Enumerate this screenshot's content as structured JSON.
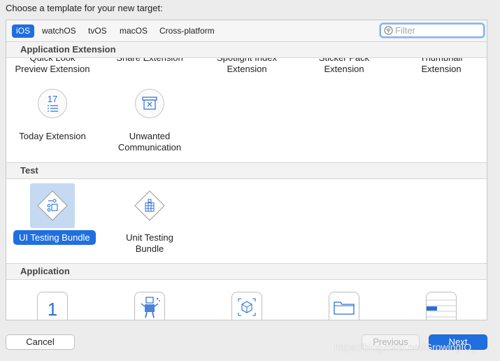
{
  "dialog": {
    "heading": "Choose a template for your new target:"
  },
  "platform_tabs": [
    {
      "label": "iOS",
      "selected": true
    },
    {
      "label": "watchOS",
      "selected": false
    },
    {
      "label": "tvOS",
      "selected": false
    },
    {
      "label": "macOS",
      "selected": false
    },
    {
      "label": "Cross-platform",
      "selected": false
    }
  ],
  "filter": {
    "placeholder": "Filter",
    "value": ""
  },
  "sections": {
    "app_extension": {
      "title": "Application Extension",
      "partial_items": [
        {
          "line1": "Quick Look",
          "line2": "Preview Extension"
        },
        {
          "line1": "Share Extension",
          "line2": ""
        },
        {
          "line1": "Spotlight Index",
          "line2": "Extension"
        },
        {
          "line1": "Sticker Pack",
          "line2": "Extension"
        },
        {
          "line1": "Thumbnail",
          "line2": "Extension"
        }
      ],
      "items": [
        {
          "line1": "Today Extension",
          "line2": "",
          "icon": "calendar-list-icon",
          "icon_text": "17"
        },
        {
          "line1": "Unwanted",
          "line2": "Communication",
          "icon": "envelope-x-icon"
        }
      ]
    },
    "test": {
      "title": "Test",
      "items": [
        {
          "line1": "UI Testing Bundle",
          "icon": "ui-test-icon",
          "selected": true
        },
        {
          "line1": "Unit Testing",
          "line2": "Bundle",
          "icon": "unit-test-icon",
          "selected": false
        }
      ]
    },
    "application": {
      "title": "Application",
      "items": [
        {
          "icon": "single-view-app-icon",
          "icon_text": "1"
        },
        {
          "icon": "game-app-icon"
        },
        {
          "icon": "augmented-reality-app-icon"
        },
        {
          "icon": "document-app-icon"
        },
        {
          "icon": "tabbed-app-icon"
        }
      ]
    }
  },
  "buttons": {
    "cancel": "Cancel",
    "previous": "Previous",
    "next": "Next"
  },
  "watermark": "https://blog.csdn.net/GrowingIO_",
  "colors": {
    "accent": "#1f6fe0",
    "selection_bg": "#c5d9f2",
    "dialog_bg": "#ececec"
  }
}
